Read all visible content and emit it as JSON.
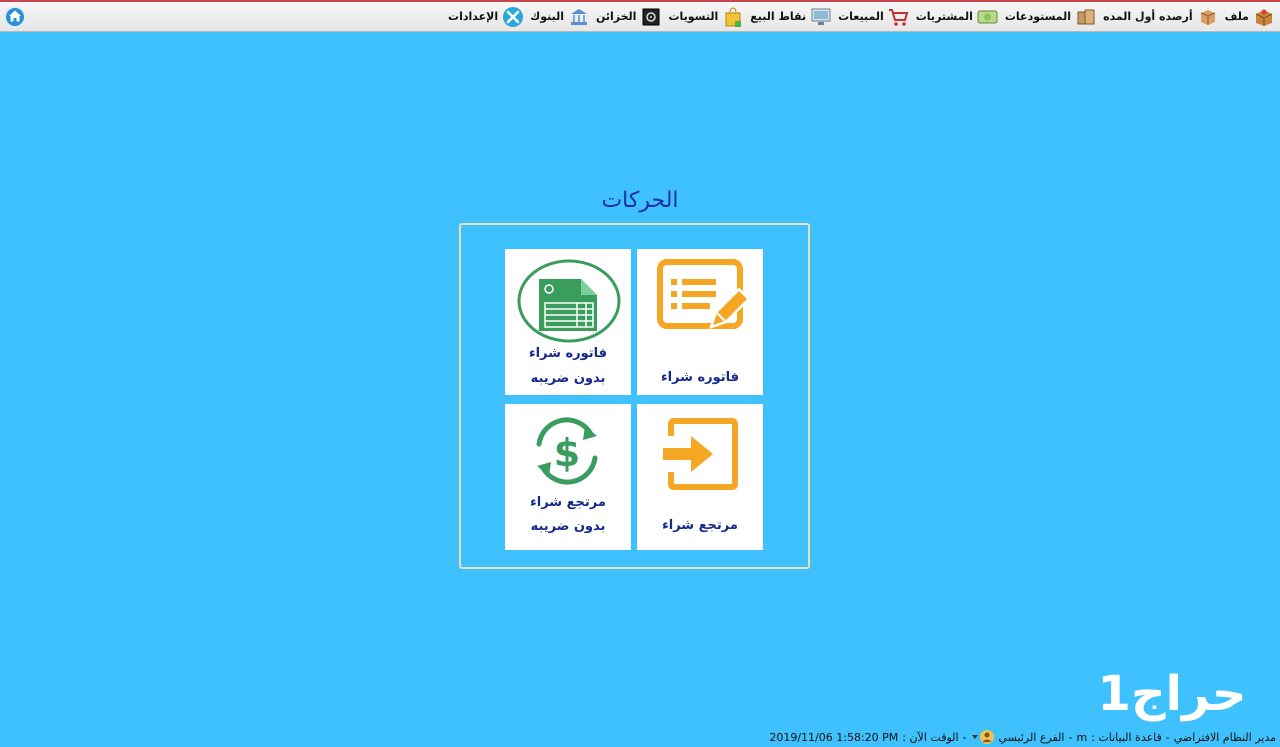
{
  "menu": [
    {
      "id": "file",
      "label": "ملف",
      "icon": "box-icon"
    },
    {
      "id": "opening-balances",
      "label": "أرصده أول المده",
      "icon": "parcel-icon"
    },
    {
      "id": "warehouses",
      "label": "المستودعات",
      "icon": "boxes-icon"
    },
    {
      "id": "purchases",
      "label": "المشتريات",
      "icon": "money-icon"
    },
    {
      "id": "sales",
      "label": "المبيعات",
      "icon": "cart-icon"
    },
    {
      "id": "pos",
      "label": "نقاط البيع",
      "icon": "monitor-icon"
    },
    {
      "id": "settlements",
      "label": "التسويات",
      "icon": "bag-icon"
    },
    {
      "id": "safes",
      "label": "الخزائن",
      "icon": "safe-icon"
    },
    {
      "id": "banks",
      "label": "البنوك",
      "icon": "bank-icon"
    },
    {
      "id": "settings",
      "label": "الإعدادات",
      "icon": "tools-icon"
    }
  ],
  "section": {
    "title": "الحركات"
  },
  "tiles": {
    "purchase_invoice": {
      "line1": "فاتوره شراء"
    },
    "purchase_invoice_no_tax": {
      "line1": "فاتوره شراء",
      "line2": "بدون ضريبه"
    },
    "purchase_return": {
      "line1": "مرتجع شراء"
    },
    "purchase_return_no_tax": {
      "line1": "مرتجع شراء",
      "line2": "بدون ضريبه"
    }
  },
  "status": {
    "user": "مدير النظام الافتراضي",
    "sep1": "-",
    "db_label": "قاعدة البيانات :",
    "db_value": "m",
    "sep2": "-",
    "branch": "الفرع الرئيسي",
    "sep3": "-",
    "time_label": "الوقت الآن :",
    "time_value": "2019/11/06  1:58:20 PM"
  },
  "watermark": "حراج1",
  "colors": {
    "background": "#3ec1fd",
    "tile_label": "#142a8c",
    "orange": "#f5a623",
    "green": "#3a9d5d"
  }
}
